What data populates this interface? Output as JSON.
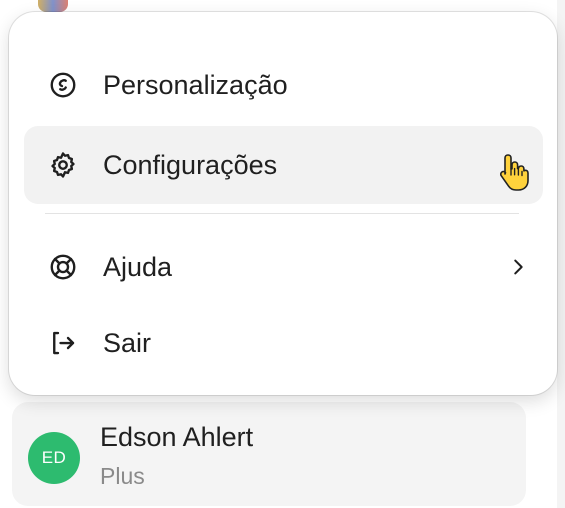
{
  "menu": {
    "items": [
      {
        "label": "Personalização",
        "icon": "personalization-icon"
      },
      {
        "label": "Configurações",
        "icon": "gear-icon",
        "state": "hovered"
      },
      {
        "label": "Ajuda",
        "icon": "lifebuoy-icon",
        "submenu_indicator": "chevron-right-icon"
      },
      {
        "label": "Sair",
        "icon": "logout-icon"
      }
    ]
  },
  "user": {
    "initials": "ED",
    "name": "Edson Ahlert",
    "plan": "Plus",
    "avatar_color": "#2dbb6f"
  },
  "colors": {
    "text": "#202020",
    "muted_text": "#8a8a8a",
    "hover_bg": "#f2f2f2",
    "card_bg": "#f4f4f4"
  }
}
